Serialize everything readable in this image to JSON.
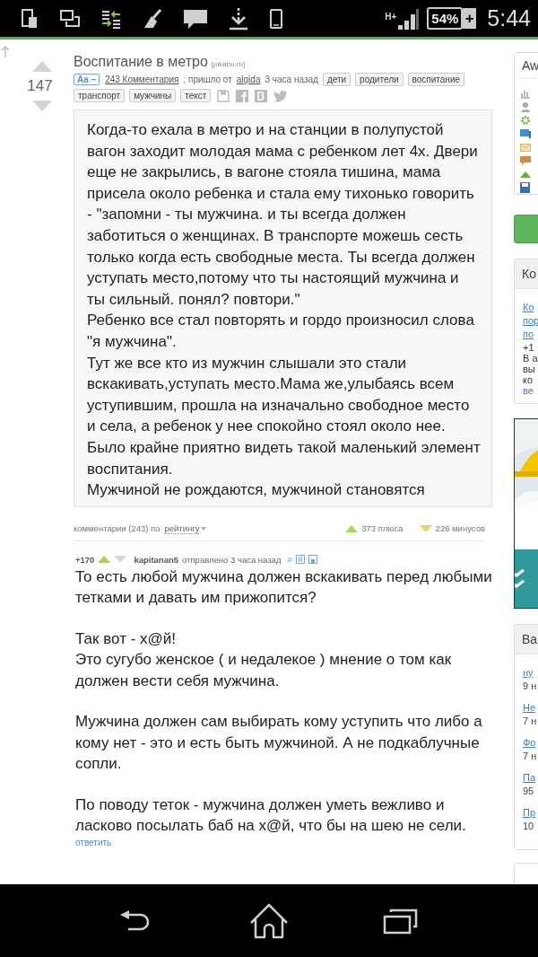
{
  "status_bar": {
    "network": "H+",
    "battery": "54%",
    "charging": "+",
    "time": "5:44"
  },
  "post": {
    "score": "147",
    "title": "Воспитание в метро",
    "source": "[pikabu.ru]",
    "font_toggle": "Aa –",
    "comments_link": "243 Комментария",
    "from_text": "; пришло от",
    "author": "algida",
    "time": "3 часа назад",
    "tags": [
      "дети",
      "родители",
      "воспитание",
      "транспорт",
      "мужчины",
      "текст"
    ],
    "body": "Когда-то ехала в метро и на станции в полупустой вагон заходит молодая мама с ребенком лет 4х. Двери еще не закрылись, в вагоне стояла тишина, мама присела около ребенка и стала ему тихонько говорить - \"запомни - ты мужчина. и ты всегда должен заботиться о женщинах. В транспорте можешь сесть только когда есть свободные места. Ты всегда должен уступать место,потому что ты настоящий мужчина и ты сильный. понял? повтори.\"\nРебенко все стал повторять и гордо произносил слова \"я мужчина\".\nТут же все кто из мужчин слышали это стали вскакивать,уступать место.Мама же,улыбаясь всем уступившим, прошла на изначально свободное место и села, а ребенок у нее спокойно стоял около нее.\nБыло крайне приятно видеть такой маленький элемент воспитания.\nМужчиной не рождаются, мужчиной становятся"
  },
  "comments_bar": {
    "label": "комментарии (243) по",
    "sort": "рейтингу",
    "pluses": "373 плюса",
    "minuses": "226 минусов"
  },
  "comments": [
    {
      "score": "+170",
      "author": "kapitanan5",
      "sent": "отправлено 3 часа назад",
      "anchor": "#",
      "paragraphs": [
        "То есть любой мужчина должен вскакивать перед любыми тетками и давать им прижопится?",
        "Так вот - х@й!\nЭто сугубо женское ( и недалекое ) мнение о том как должен вести себя мужчина.",
        "Мужчина должен сам выбирать кому уступить что либо а кому нет - это и есть быть мужчиной. А не подкаблучные сопли.",
        "По поводу теток - мужчина должен уметь вежливо и ласково посылать баб на х@й, что бы на шею не сели."
      ],
      "reply": "ответить"
    }
  ],
  "sidebar": [
    {
      "kind": "menu",
      "title": "Aw"
    },
    {
      "kind": "button"
    },
    {
      "kind": "list",
      "title": "Ко",
      "items": [
        {
          "kind": "link",
          "text": "Ко"
        },
        {
          "kind": "link",
          "text": "пор"
        },
        {
          "kind": "link",
          "text": "по"
        },
        {
          "kind": "text",
          "text": "+1"
        },
        {
          "kind": "text",
          "text": "В а"
        },
        {
          "kind": "text",
          "text": "вы"
        },
        {
          "kind": "text",
          "text": "ко"
        },
        {
          "kind": "more",
          "text": "ве"
        }
      ]
    },
    {
      "kind": "ad"
    },
    {
      "kind": "list",
      "title": "Ва",
      "items": [
        {
          "kind": "link",
          "text": "ну"
        },
        {
          "kind": "sub",
          "text": "9 н"
        },
        {
          "kind": "link",
          "text": "Не"
        },
        {
          "kind": "sub",
          "text": "7 н"
        },
        {
          "kind": "link",
          "text": "Фо"
        },
        {
          "kind": "sub",
          "text": "7 н"
        },
        {
          "kind": "link",
          "text": "Па"
        },
        {
          "kind": "sub",
          "text": "95"
        },
        {
          "kind": "link",
          "text": "Пр"
        },
        {
          "kind": "sub",
          "text": "10"
        }
      ]
    },
    {
      "kind": "panel"
    }
  ]
}
